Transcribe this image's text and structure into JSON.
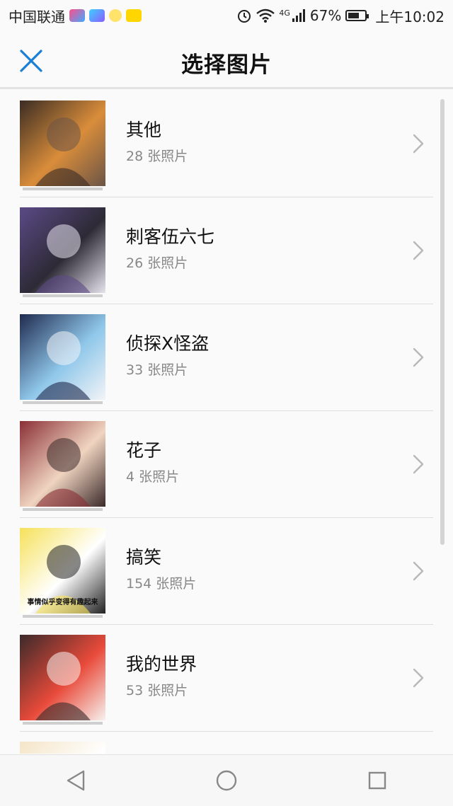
{
  "status_bar": {
    "carrier": "中国联通",
    "battery": "67%",
    "battery_level": 0.67,
    "time": "上午10:02",
    "network": "4G",
    "app_icons": [
      "video-app-icon",
      "play-app-icon",
      "idea-app-icon",
      "kuaishou-app-icon"
    ]
  },
  "header": {
    "title": "选择图片",
    "close_icon": "close-icon"
  },
  "albums": [
    {
      "name": "其他",
      "count": "28 张照片",
      "colors": [
        "#3a2c24",
        "#d98d3a",
        "#6b5447"
      ]
    },
    {
      "name": "刺客伍六七",
      "count": "26 张照片",
      "colors": [
        "#5b4a86",
        "#2d2a36",
        "#e8e4ee"
      ]
    },
    {
      "name": "侦探X怪盗",
      "count": "33 张照片",
      "colors": [
        "#1f2a4e",
        "#8fc7ea",
        "#f3f4f7"
      ]
    },
    {
      "name": "花子",
      "count": "4 张照片",
      "colors": [
        "#8a2f36",
        "#f0d4c0",
        "#3b2a2a"
      ]
    },
    {
      "name": "搞笑",
      "count": "154 张照片",
      "colors": [
        "#f6e15a",
        "#ffffff",
        "#222222"
      ],
      "caption": "事情似乎变得有趣起来"
    },
    {
      "name": "我的世界",
      "count": "53 张照片",
      "colors": [
        "#3b2a2a",
        "#e84a3a",
        "#f7f2ee"
      ]
    },
    {
      "name": "",
      "count": "",
      "colors": [
        "#f4e5c8",
        "#ffffff",
        "#e0c9a0"
      ]
    }
  ],
  "navbar": {
    "back_icon": "back-triangle-icon",
    "home_icon": "home-circle-icon",
    "recents_icon": "recents-square-icon"
  }
}
